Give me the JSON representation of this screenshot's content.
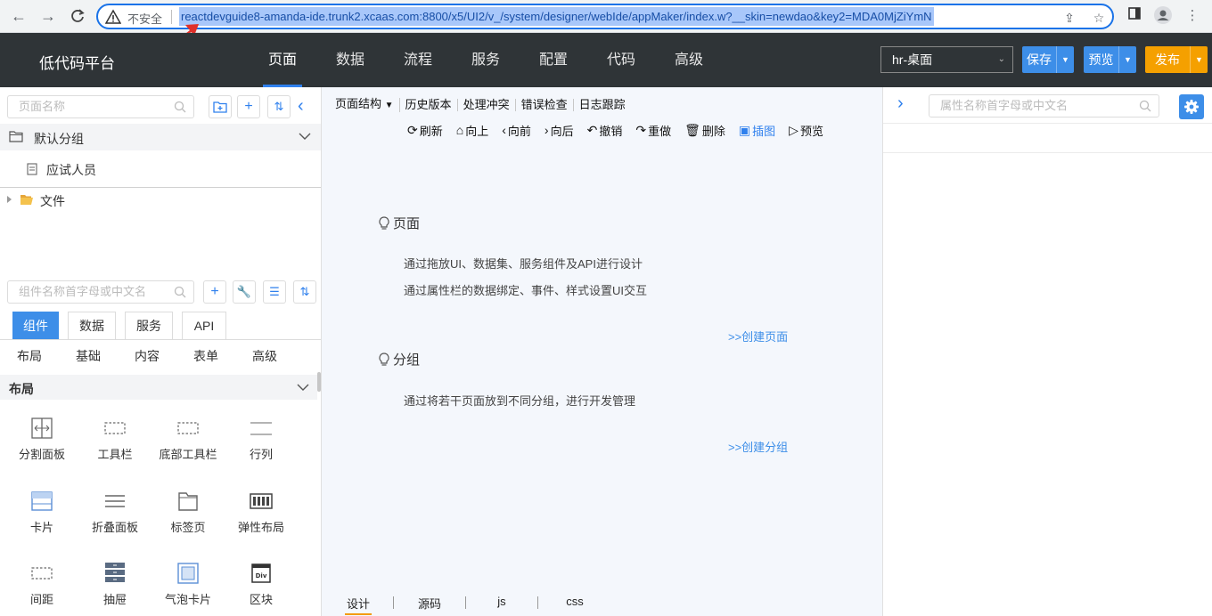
{
  "browser": {
    "insecure_label": "不安全",
    "url": "reactdevguide8-amanda-ide.trunk2.xcaas.com:8800/x5/UI2/v_/system/designer/webIde/appMaker/index.w?__skin=newdao&key2=MDA0MjZiYmN"
  },
  "header": {
    "app_title": "低代码平台",
    "nav": [
      "页面",
      "数据",
      "流程",
      "服务",
      "配置",
      "代码",
      "高级"
    ],
    "active_nav": "页面",
    "env_select": "hr-桌面",
    "save_label": "保存",
    "preview_label": "预览",
    "publish_label": "发布",
    "colors": {
      "save": "#3d8ee8",
      "preview": "#3d8ee8",
      "publish": "#f5a000",
      "header_bg": "#2f3437"
    }
  },
  "left": {
    "page_search_placeholder": "页面名称",
    "default_group": "默认分组",
    "page_item": "应试人员",
    "file_node": "文件",
    "component_search_placeholder": "组件名称首字母或中文名",
    "tabs": [
      "组件",
      "数据",
      "服务",
      "API"
    ],
    "categories": [
      "布局",
      "基础",
      "内容",
      "表单",
      "高级"
    ],
    "section_title": "布局",
    "widgets": [
      {
        "label": "分割面板",
        "icon": "split-panel-icon"
      },
      {
        "label": "工具栏",
        "icon": "toolbar-icon"
      },
      {
        "label": "底部工具栏",
        "icon": "bottom-toolbar-icon"
      },
      {
        "label": "行列",
        "icon": "row-col-icon"
      },
      {
        "label": "卡片",
        "icon": "card-icon"
      },
      {
        "label": "折叠面板",
        "icon": "collapse-icon"
      },
      {
        "label": "标签页",
        "icon": "tabs-icon"
      },
      {
        "label": "弹性布局",
        "icon": "flex-layout-icon"
      },
      {
        "label": "间距",
        "icon": "spacing-icon"
      },
      {
        "label": "抽屉",
        "icon": "drawer-icon"
      },
      {
        "label": "气泡卡片",
        "icon": "popover-icon"
      },
      {
        "label": "区块",
        "icon": "div-block-icon"
      }
    ]
  },
  "center": {
    "toolbar1": [
      "页面结构",
      "历史版本",
      "处理冲突",
      "错误检查",
      "日志跟踪"
    ],
    "toolbar2": [
      {
        "label": "刷新",
        "glyph": "⟳"
      },
      {
        "label": "向上",
        "glyph": "⌂"
      },
      {
        "label": "向前",
        "glyph": "‹"
      },
      {
        "label": "向后",
        "glyph": "›"
      },
      {
        "label": "撤销",
        "glyph": "↶"
      },
      {
        "label": "重做",
        "glyph": "↷"
      },
      {
        "label": "删除",
        "glyph": "🗑"
      },
      {
        "label": "插图",
        "glyph": "▣"
      },
      {
        "label": "预览",
        "glyph": "▷"
      }
    ],
    "page_heading": "页面",
    "page_line1": "通过拖放UI、数据集、服务组件及API进行设计",
    "page_line2": "通过属性栏的数据绑定、事件、样式设置UI交互",
    "create_page_link": ">>创建页面",
    "group_heading": "分组",
    "group_line1": "通过将若干页面放到不同分组，进行开发管理",
    "create_group_link": ">>创建分组",
    "bottom_tabs": [
      "设计",
      "源码",
      "js",
      "css"
    ],
    "active_bottom_tab": "设计"
  },
  "right": {
    "property_search_placeholder": "属性名称首字母或中文名"
  }
}
